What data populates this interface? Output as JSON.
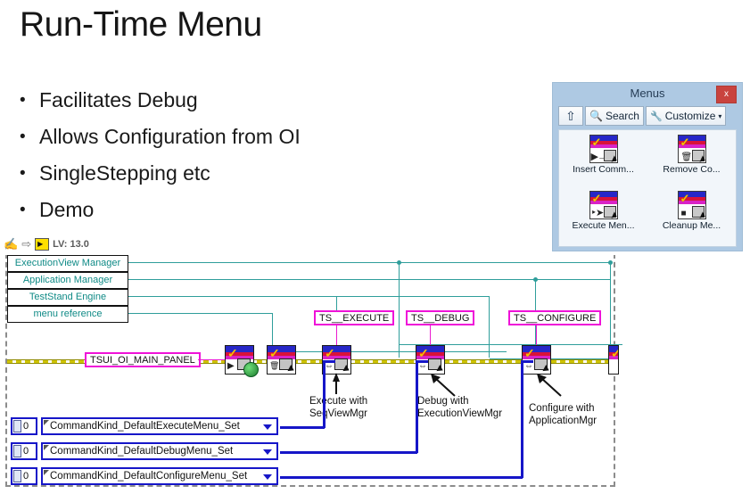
{
  "slide": {
    "title": "Run-Time Menu",
    "bullets": [
      "Facilitates Debug",
      "Allows Configuration from OI",
      "SingleStepping etc",
      "Demo"
    ]
  },
  "menus_window": {
    "title": "Menus",
    "close_label": "x",
    "titlebar_color": "#aec9e3",
    "close_color": "#c9433e",
    "toolbar": [
      {
        "icon": "up-arrow-icon",
        "label": ""
      },
      {
        "icon": "magnifier-icon",
        "label": "Search"
      },
      {
        "icon": "wrench-icon",
        "label": "Customize",
        "caret": "▾"
      }
    ],
    "items": [
      {
        "icon": "insert-command-icon",
        "label": "Insert Comm..."
      },
      {
        "icon": "remove-command-icon",
        "label": "Remove Co..."
      },
      {
        "icon": "execute-menu-icon",
        "label": "Execute Men..."
      },
      {
        "icon": "cleanup-menu-icon",
        "label": "Cleanup Me..."
      }
    ]
  },
  "lv_toolbar": {
    "hand_icon": "hand-cursor-icon",
    "arrow_icon": "arrow-icon",
    "lv_icon": "labview-icon",
    "version": "LV: 13.0"
  },
  "block_diagram": {
    "terminals": [
      "ExecutionView Manager",
      "Application Manager",
      "TestStand Engine",
      "menu reference"
    ],
    "labels": [
      "TSUI_OI_MAIN_PANEL",
      "TS__EXECUTE",
      "TS__DEBUG",
      "TS__CONFIGURE"
    ],
    "annotations": [
      {
        "line1": "Execute with",
        "line2": "SeqViewMgr"
      },
      {
        "line1": "Debug with",
        "line2": "ExecutionViewMgr"
      },
      {
        "line1": "Configure with",
        "line2": "ApplicationMgr"
      }
    ],
    "enum_controls": [
      {
        "numeric": "0",
        "value": "CommandKind_DefaultExecuteMenu_Set"
      },
      {
        "numeric": "0",
        "value": "CommandKind_DefaultDebugMenu_Set"
      },
      {
        "numeric": "0",
        "value": "CommandKind_DefaultConfigureMenu_Set"
      }
    ],
    "colors": {
      "reference_wire": "#2f9e9b",
      "enum_wire": "#1616c8",
      "error_wire": "#cfc400",
      "label_border": "#ef12d8",
      "terminal_text": "#0f8a86"
    }
  }
}
